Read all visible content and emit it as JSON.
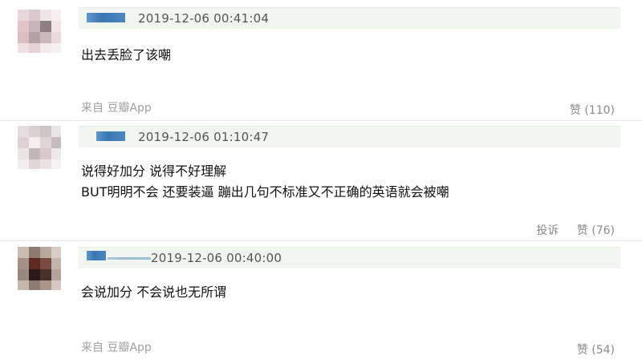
{
  "comments": [
    {
      "timestamp": "2019-12-06 00:41:04",
      "lines": [
        "出去丢脸了该嘲"
      ],
      "source": "来自 豆瓣App",
      "report": "",
      "like_label": "赞 (110)"
    },
    {
      "timestamp": "2019-12-06 01:10:47",
      "lines": [
        "说得好加分 说得不好理解",
        "BUT明明不会 还要装逼 蹦出几句不标准又不正确的英语就会被嘲"
      ],
      "source": "",
      "report": "投诉",
      "like_label": "赞 (76)"
    },
    {
      "timestamp": "2019-12-06 00:40:00",
      "timestamp_display": "2019-12-06 00:40:00",
      "lines": [
        "会说加分 不会说也无所谓"
      ],
      "source": "来自 豆瓣App",
      "report": "",
      "like_label": "赞 (54)"
    }
  ],
  "colors": {
    "header_bg": "#f0f6ef",
    "username_blue": "#2f6fb0",
    "meta_gray": "#8a8a8a",
    "source_gray": "#a0a0a0"
  }
}
